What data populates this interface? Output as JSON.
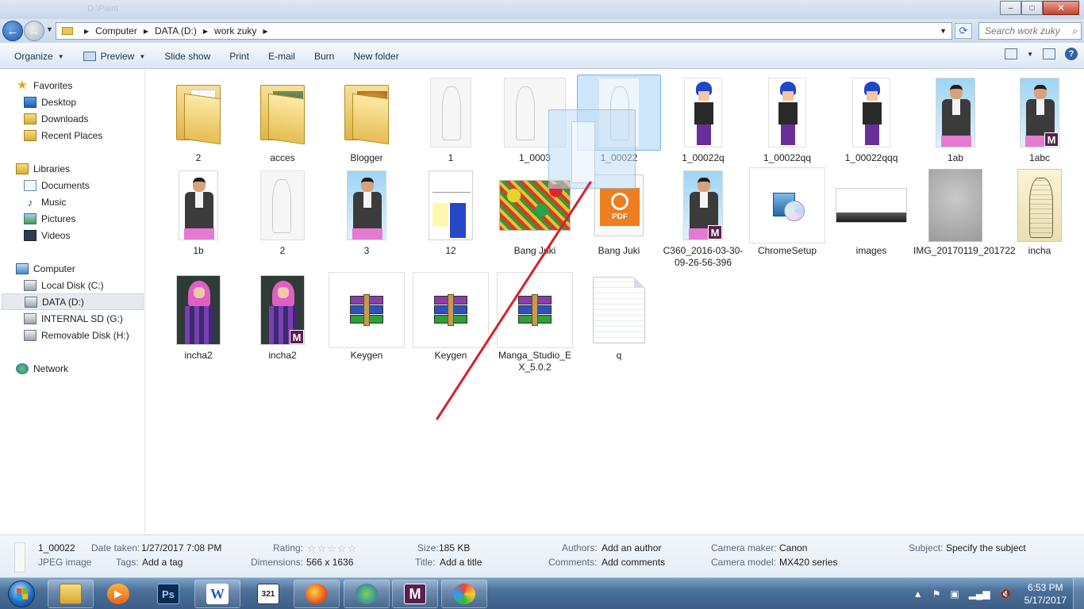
{
  "window": {
    "ghost_title": "D:\\Paint",
    "controls": {
      "minimize": "–",
      "maximize": "□",
      "close": "✕"
    }
  },
  "address": {
    "crumbs": [
      "Computer",
      "DATA (D:)",
      "work zuky"
    ],
    "search_placeholder": "Search work zuky"
  },
  "toolbar": {
    "organize": "Organize",
    "preview": "Preview",
    "slideshow": "Slide show",
    "print": "Print",
    "email": "E-mail",
    "burn": "Burn",
    "new_folder": "New folder",
    "help": "?"
  },
  "nav": {
    "favorites": "Favorites",
    "desktop": "Desktop",
    "downloads": "Downloads",
    "recent": "Recent Places",
    "libraries": "Libraries",
    "documents": "Documents",
    "music": "Music",
    "pictures": "Pictures",
    "videos": "Videos",
    "computer": "Computer",
    "local_c": "Local Disk (C:)",
    "data_d": "DATA (D:)",
    "internal_g": "INTERNAL SD (G:)",
    "removable_h": "Removable Disk (H:)",
    "network": "Network"
  },
  "files": [
    {
      "name": "2",
      "icon": "folder-icon"
    },
    {
      "name": "acces",
      "icon": "folder-icon"
    },
    {
      "name": "Blogger",
      "icon": "folder-icon"
    },
    {
      "name": "1",
      "icon": "image-icon"
    },
    {
      "name": "1_0003",
      "icon": "image-icon"
    },
    {
      "name": "1_00022",
      "icon": "image-icon"
    },
    {
      "name": "1_00022q",
      "icon": "image-icon"
    },
    {
      "name": "1_00022qq",
      "icon": "image-icon"
    },
    {
      "name": "1_00022qqq",
      "icon": "image-icon"
    },
    {
      "name": "1ab",
      "icon": "image-icon"
    },
    {
      "name": "1abc",
      "icon": "image-icon"
    },
    {
      "name": "1b",
      "icon": "image-icon"
    },
    {
      "name": "2",
      "icon": "image-icon"
    },
    {
      "name": "3",
      "icon": "image-icon"
    },
    {
      "name": "12",
      "icon": "image-icon"
    },
    {
      "name": "Bang Juki",
      "icon": "image-icon"
    },
    {
      "name": "Bang Juki",
      "icon": "pdf-icon"
    },
    {
      "name": "C360_2016-03-30-09-26-56-396",
      "icon": "image-icon"
    },
    {
      "name": "ChromeSetup",
      "icon": "installer-icon"
    },
    {
      "name": "images",
      "icon": "image-icon"
    },
    {
      "name": "IMG_20170119_201722",
      "icon": "image-icon"
    },
    {
      "name": "incha",
      "icon": "image-icon"
    },
    {
      "name": "incha2",
      "icon": "image-icon"
    },
    {
      "name": "incha2",
      "icon": "image-icon"
    },
    {
      "name": "Keygen",
      "icon": "winrar-icon"
    },
    {
      "name": "Keygen",
      "icon": "winrar-icon"
    },
    {
      "name": "Manga_Studio_EX_5.0.2",
      "icon": "winrar-icon"
    },
    {
      "name": "q",
      "icon": "text-file-icon"
    }
  ],
  "details": {
    "filename": "1_00022",
    "filetype": "JPEG image",
    "date_taken_label": "Date taken:",
    "date_taken": "1/27/2017 7:08 PM",
    "tags_label": "Tags:",
    "tags": "Add a tag",
    "rating_label": "Rating:",
    "rating_stars": "☆☆☆☆☆",
    "dimensions_label": "Dimensions:",
    "dimensions": "566 x 1636",
    "size_label": "Size:",
    "size": "185 KB",
    "title_label": "Title:",
    "title": "Add a title",
    "authors_label": "Authors:",
    "authors": "Add an author",
    "comments_label": "Comments:",
    "comments": "Add comments",
    "camera_maker_label": "Camera maker:",
    "camera_maker": "Canon",
    "camera_model_label": "Camera model:",
    "camera_model": "MX420 series",
    "subject_label": "Subject:",
    "subject": "Specify the subject"
  },
  "taskbar": {
    "apps": [
      {
        "name": "Windows Explorer",
        "icon": "explorer-icon"
      },
      {
        "name": "Media Player",
        "icon": "media-player-icon"
      },
      {
        "name": "Photoshop",
        "icon": "photoshop-icon",
        "text": "Ps"
      },
      {
        "name": "Word",
        "icon": "word-icon",
        "text": "W"
      },
      {
        "name": "Codec",
        "icon": "codec-icon",
        "text": "321"
      },
      {
        "name": "Firefox",
        "icon": "firefox-icon"
      },
      {
        "name": "IDM",
        "icon": "download-manager-icon"
      },
      {
        "name": "Manga Studio",
        "icon": "manga-studio-icon",
        "text": "M"
      },
      {
        "name": "Paint",
        "icon": "paint-icon"
      }
    ],
    "time": "6:53 PM",
    "date": "5/17/2017"
  },
  "colors": {
    "accent": "#2f63ad",
    "selection": "#cde6fb",
    "drag_line": "#d6202e"
  }
}
